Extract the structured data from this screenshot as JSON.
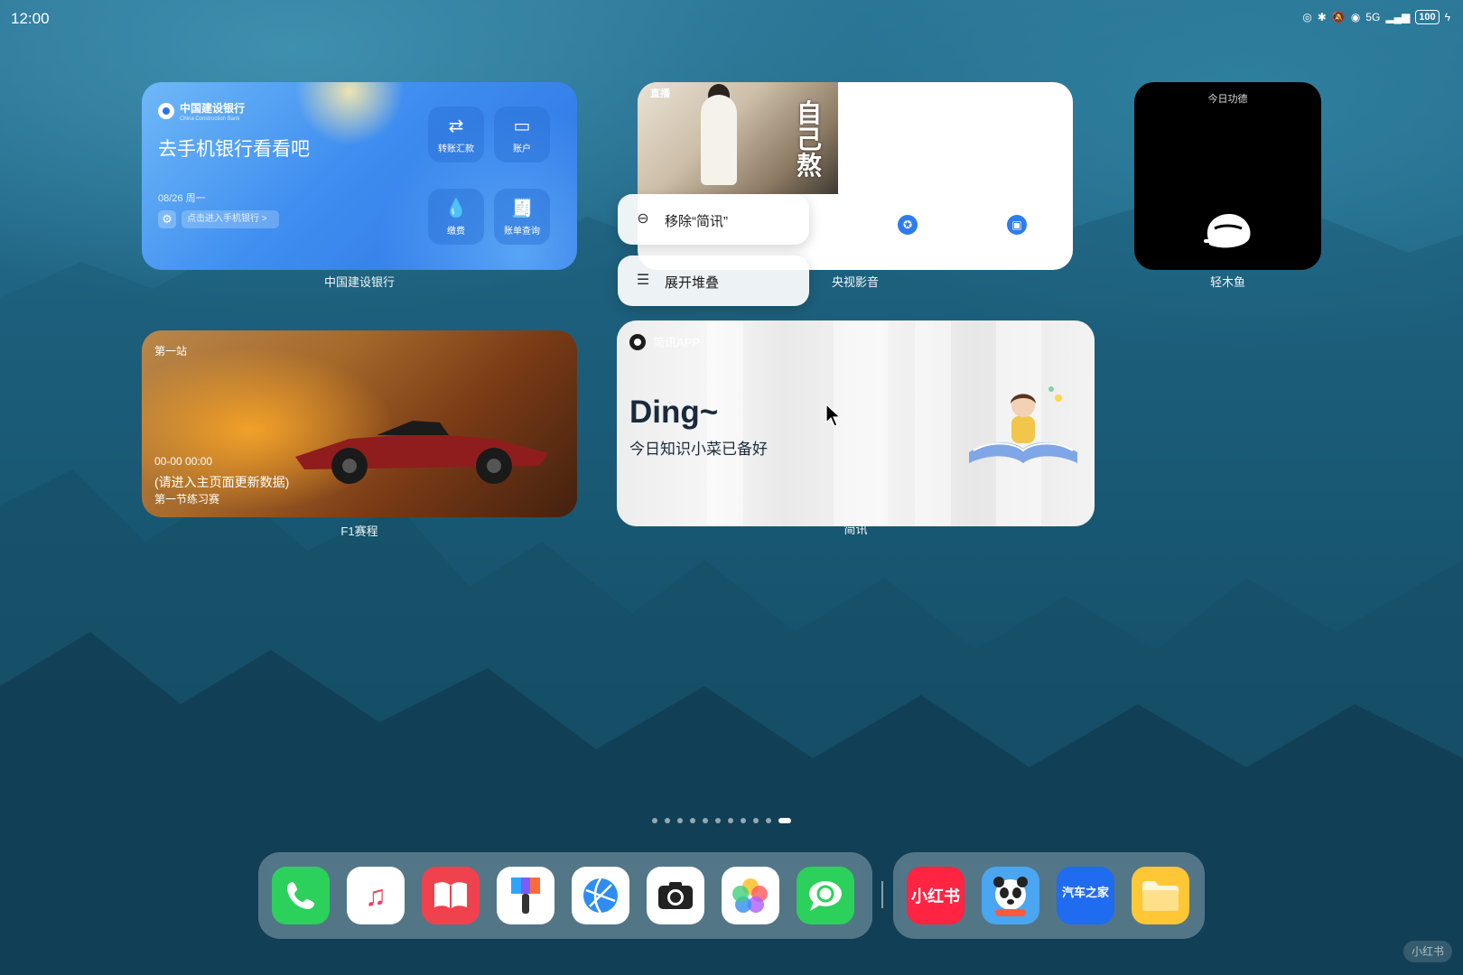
{
  "status_bar": {
    "time": "12:00",
    "battery": "100",
    "network": "5G"
  },
  "widgets": {
    "ccb": {
      "logo_name": "中国建设银行",
      "logo_sub": "China Construction Bank",
      "title": "去手机银行看看吧",
      "date": "08/26 周一",
      "link": "点击进入手机银行 >",
      "buttons": [
        {
          "label": "转账汇款",
          "icon": "transfer-icon"
        },
        {
          "label": "账户",
          "icon": "account-card-icon"
        },
        {
          "label": "缴费",
          "icon": "payment-drop-icon"
        },
        {
          "label": "账单查询",
          "icon": "bill-query-icon"
        }
      ],
      "caption": "中国建设银行"
    },
    "cctv": {
      "tag": "直播",
      "vertical_text": "自己熬",
      "caption": "央视影音"
    },
    "qingmuyu": {
      "title": "今日功德",
      "caption": "轻木鱼"
    },
    "f1": {
      "stage": "第一站",
      "time": "00-00 00:00",
      "message": "(请进入主页面更新数据)",
      "session": "第一节练习赛",
      "caption": "F1赛程"
    },
    "jianxun": {
      "brand": "简讯APP",
      "title": "Ding~",
      "subtitle": "今日知识小菜已备好",
      "caption": "简讯"
    }
  },
  "context_menu": {
    "items": [
      {
        "label": "移除“简讯”",
        "icon": "remove-circle-icon"
      },
      {
        "label": "展开堆叠",
        "icon": "stack-expand-icon"
      }
    ]
  },
  "page_indicator": {
    "count": 11,
    "active": 10
  },
  "dock": {
    "main_apps": [
      {
        "name": "phone",
        "icon": "phone-icon",
        "bg": "#2bd15a"
      },
      {
        "name": "music",
        "icon": "music-note-icon",
        "bg": "#ffffff"
      },
      {
        "name": "books",
        "icon": "book-icon",
        "bg": "#f0424e"
      },
      {
        "name": "themes",
        "icon": "paintbrush-icon",
        "bg": "#ffffff"
      },
      {
        "name": "browser",
        "icon": "globe-icon",
        "bg": "#ffffff"
      },
      {
        "name": "camera",
        "icon": "camera-icon",
        "bg": "#ffffff"
      },
      {
        "name": "gallery",
        "icon": "photos-flower-icon",
        "bg": "#ffffff"
      },
      {
        "name": "messages",
        "icon": "chat-bubble-icon",
        "bg": "#2bd15a"
      }
    ],
    "recent_apps": [
      {
        "name": "xiaohongshu",
        "label": "小红书",
        "icon": "xiaohongshu-icon",
        "bg": "#ff2442"
      },
      {
        "name": "panda-game",
        "icon": "panda-icon",
        "bg": "#4aa6f0"
      },
      {
        "name": "autohome",
        "label": "汽车之家",
        "icon": "autohome-icon",
        "bg": "#1f6cf0"
      },
      {
        "name": "files",
        "icon": "folder-icon",
        "bg": "#ffc736"
      }
    ]
  },
  "watermark": "小红书"
}
